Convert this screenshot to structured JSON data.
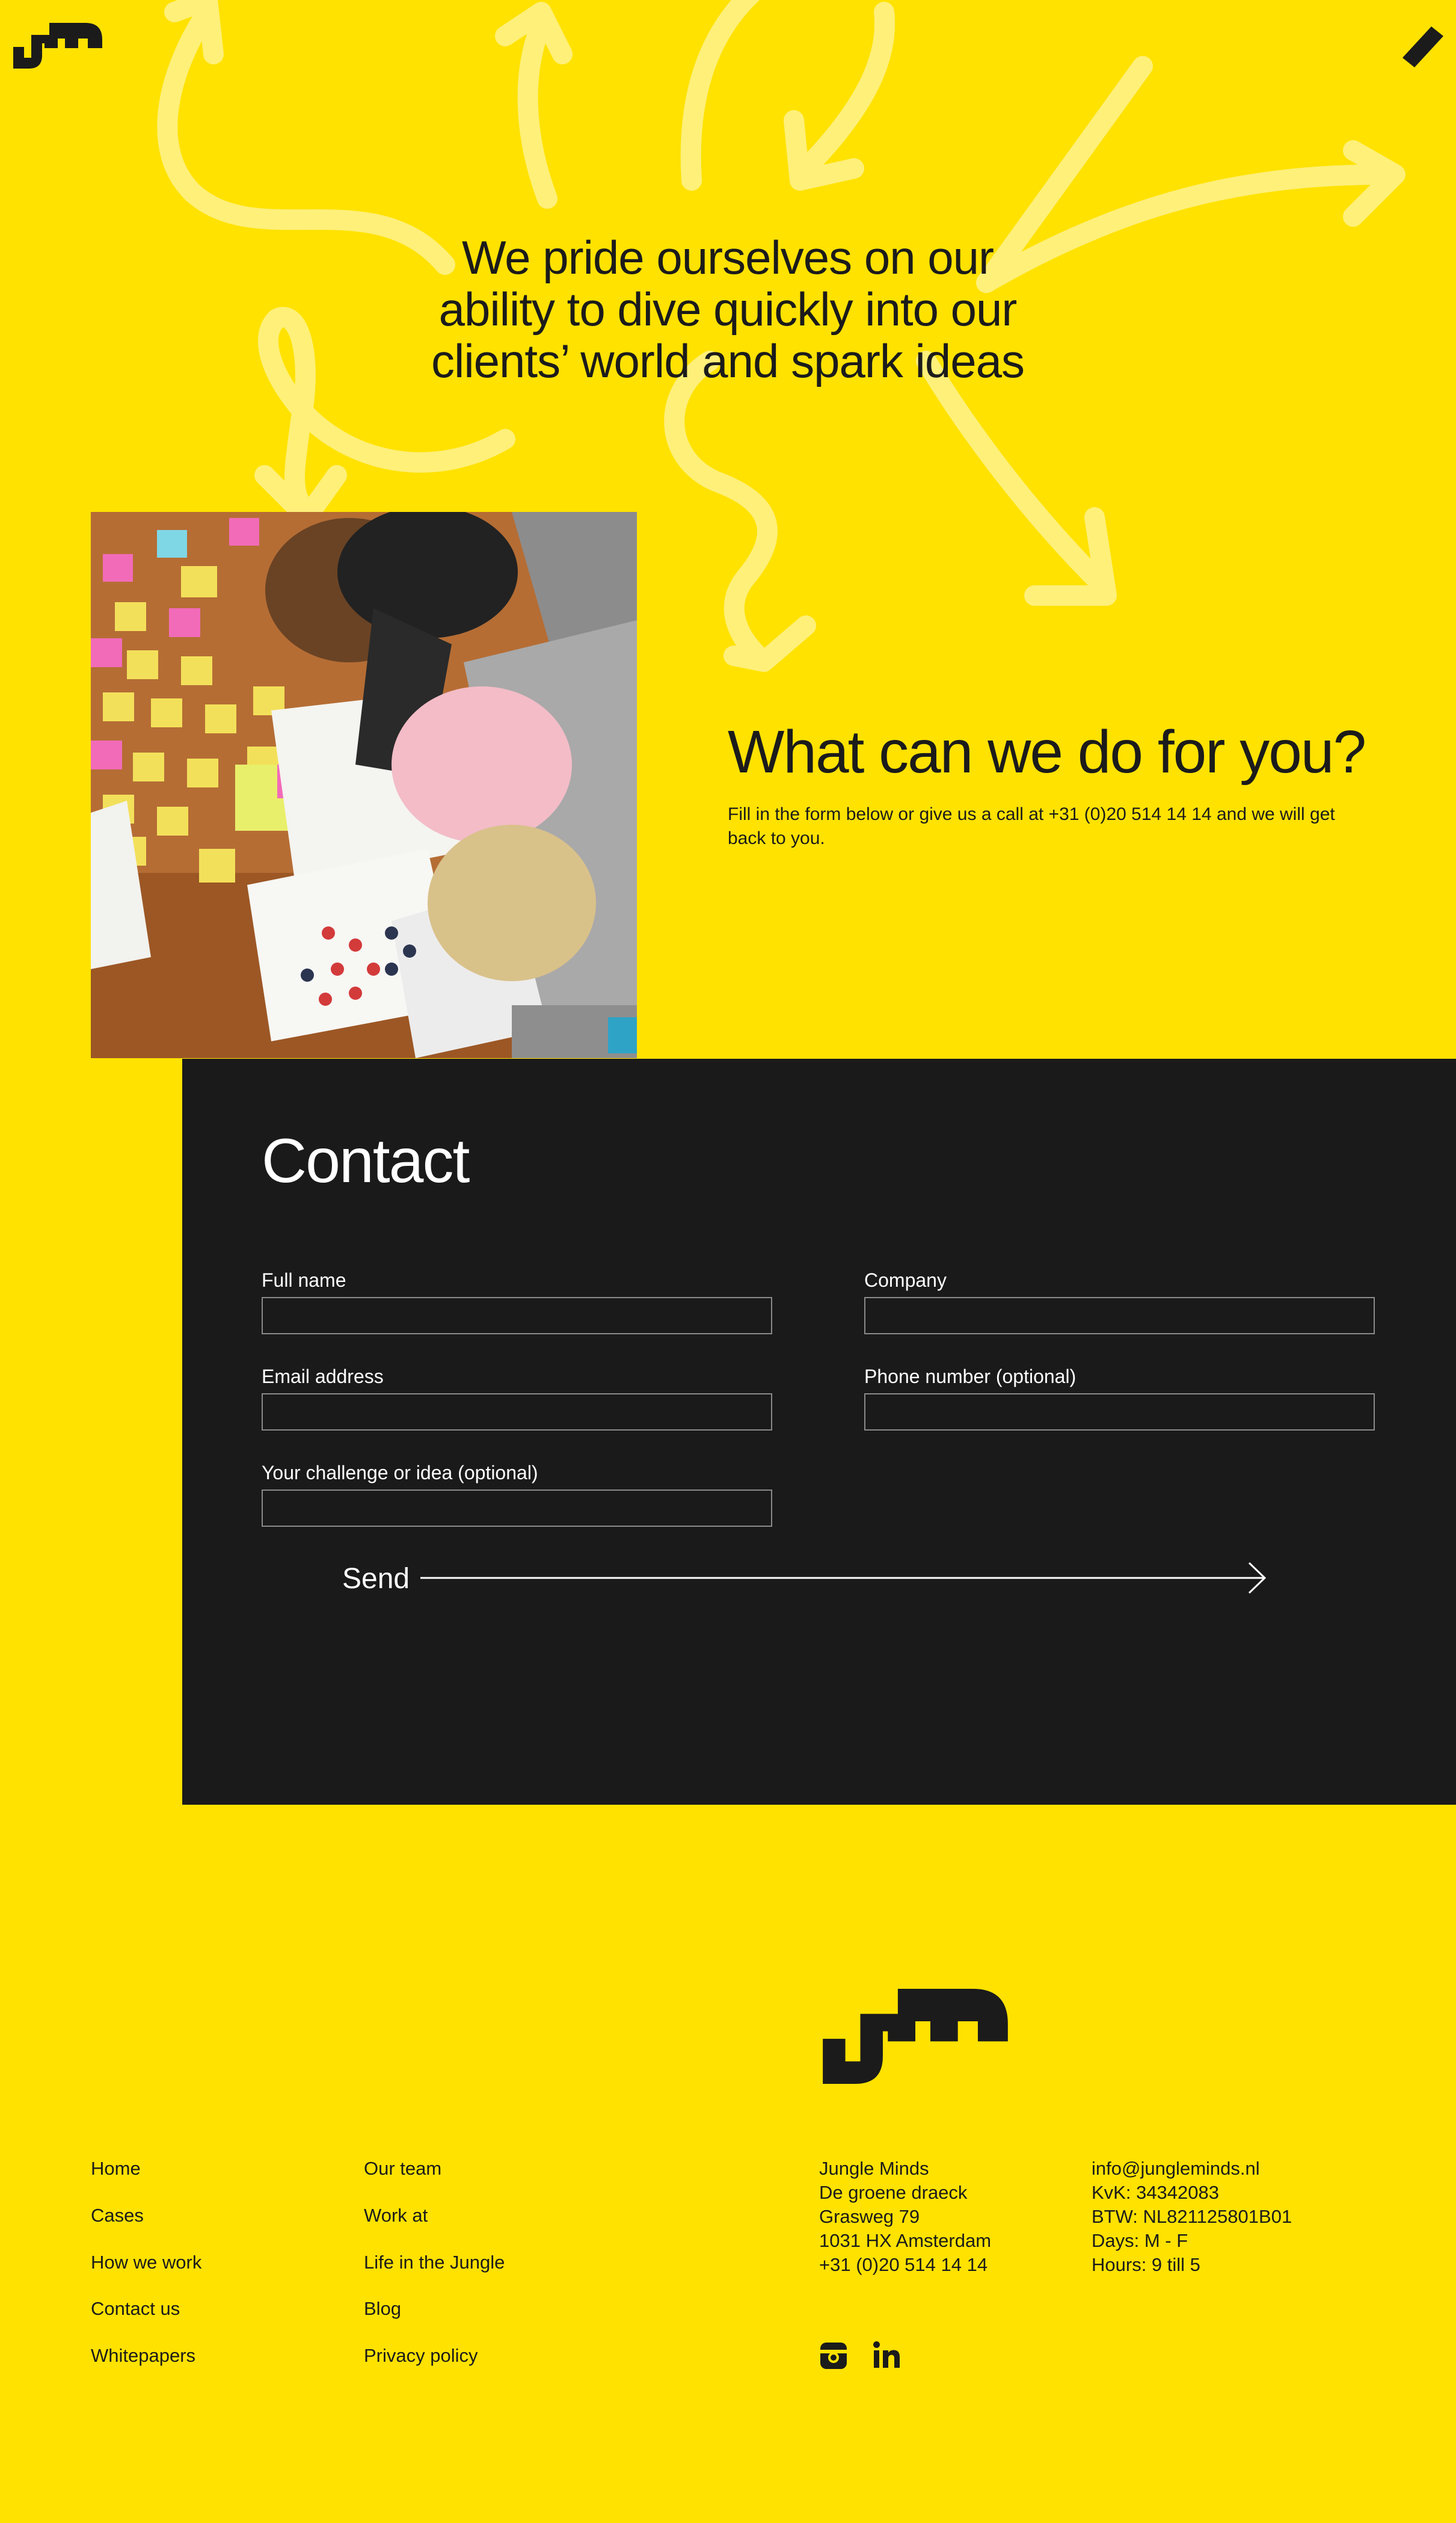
{
  "colors": {
    "background": "#FFE200",
    "dark": "#1A1A1A",
    "text": "#1B1B1B",
    "arrow": "#FFF07A"
  },
  "header": {
    "logo_icon": "jm-logo-icon",
    "menu_icon": "pencil-menu-icon"
  },
  "hero": {
    "tagline_lines": [
      "We pride ourselves on our",
      "ability to dive quickly into our",
      "clients’ world and spark ideas"
    ]
  },
  "intro": {
    "title": "What can we do for you?",
    "text": "Fill in the form below or give us a call at +31 (0)20 514 14 14 and we will get back to you."
  },
  "contact": {
    "title": "Contact",
    "fields": {
      "full_name": {
        "label": "Full name",
        "value": ""
      },
      "company": {
        "label": "Company",
        "value": ""
      },
      "email": {
        "label": "Email address",
        "value": ""
      },
      "phone": {
        "label": "Phone number (optional)",
        "value": ""
      },
      "challenge": {
        "label": "Your challenge or idea (optional)",
        "value": ""
      }
    },
    "send_label": "Send"
  },
  "footer": {
    "nav_col1": [
      "Home",
      "Cases",
      "How we work",
      "Contact us",
      "Whitepapers"
    ],
    "nav_col2": [
      "Our team",
      "Work at",
      "Life in the Jungle",
      "Blog",
      "Privacy policy"
    ],
    "address": [
      "Jungle Minds",
      "De groene draeck",
      "Grasweg 79",
      "1031 HX Amsterdam",
      "+31 (0)20 514 14 14"
    ],
    "company": [
      "info@jungleminds.nl",
      "KvK: 34342083",
      "BTW: NL821125801B01",
      "Days: M - F",
      "Hours: 9 till 5"
    ],
    "social_icons": [
      "instagram-icon",
      "linkedin-icon"
    ]
  }
}
